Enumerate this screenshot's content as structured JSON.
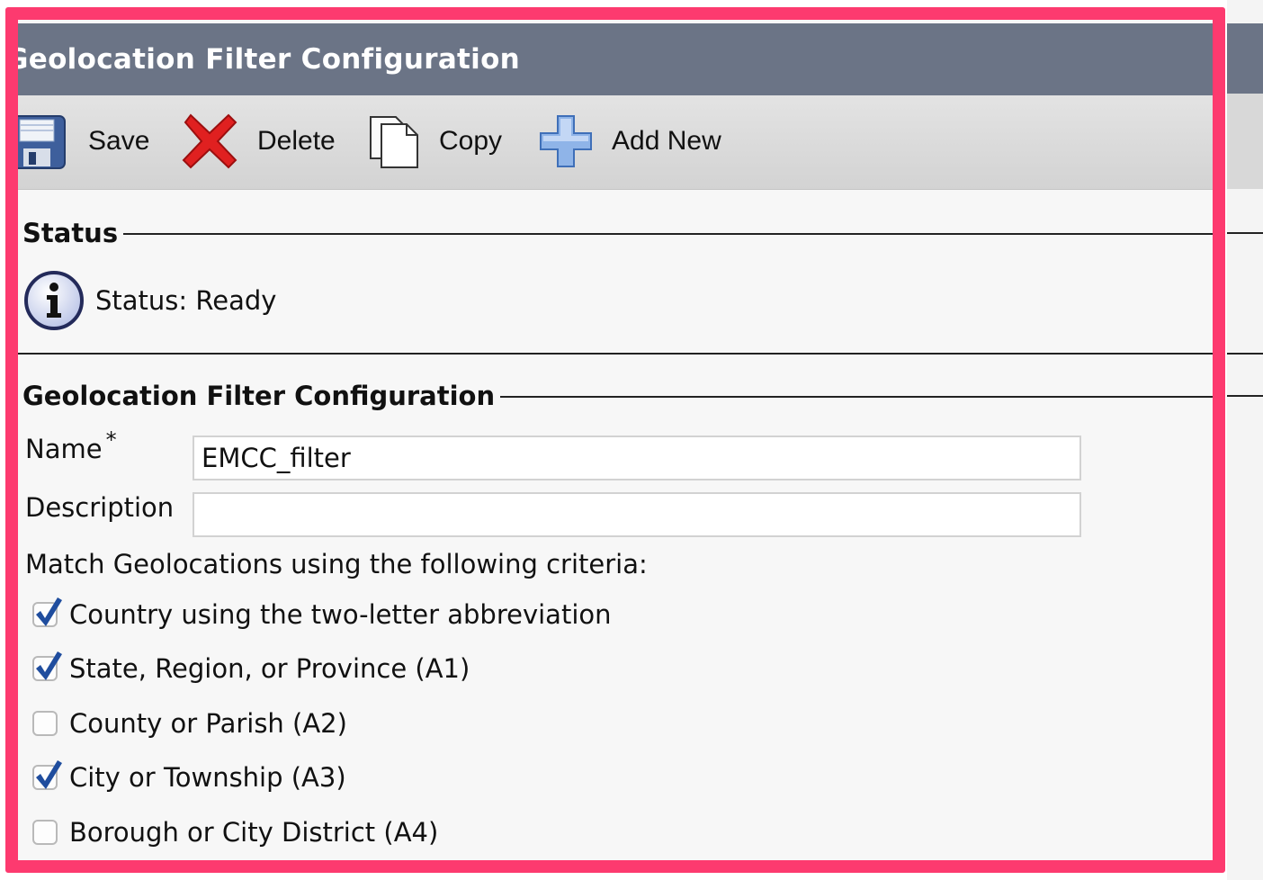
{
  "window": {
    "title": "Geolocation Filter Configuration"
  },
  "toolbar": {
    "save_label": "Save",
    "delete_label": "Delete",
    "copy_label": "Copy",
    "add_new_label": "Add New"
  },
  "status_section": {
    "heading": "Status",
    "icon": "info-icon",
    "status_text": "Status: Ready"
  },
  "config_section": {
    "heading": "Geolocation Filter Configuration",
    "name_label": "Name",
    "required_mark": "*",
    "name_value": "EMCC_filter",
    "description_label": "Description",
    "description_value": "",
    "criteria_label": "Match Geolocations using the following criteria:",
    "criteria": [
      {
        "label": "Country using the two-letter abbreviation",
        "checked": true
      },
      {
        "label": "State, Region, or Province (A1)",
        "checked": true
      },
      {
        "label": "County or Parish (A2)",
        "checked": false
      },
      {
        "label": "City or Township (A3)",
        "checked": true
      },
      {
        "label": "Borough or City District (A4)",
        "checked": false
      }
    ]
  },
  "colors": {
    "highlight_frame": "#fd3a6f",
    "title_bar": "#6b7486",
    "checkmark": "#1f4d9e"
  }
}
